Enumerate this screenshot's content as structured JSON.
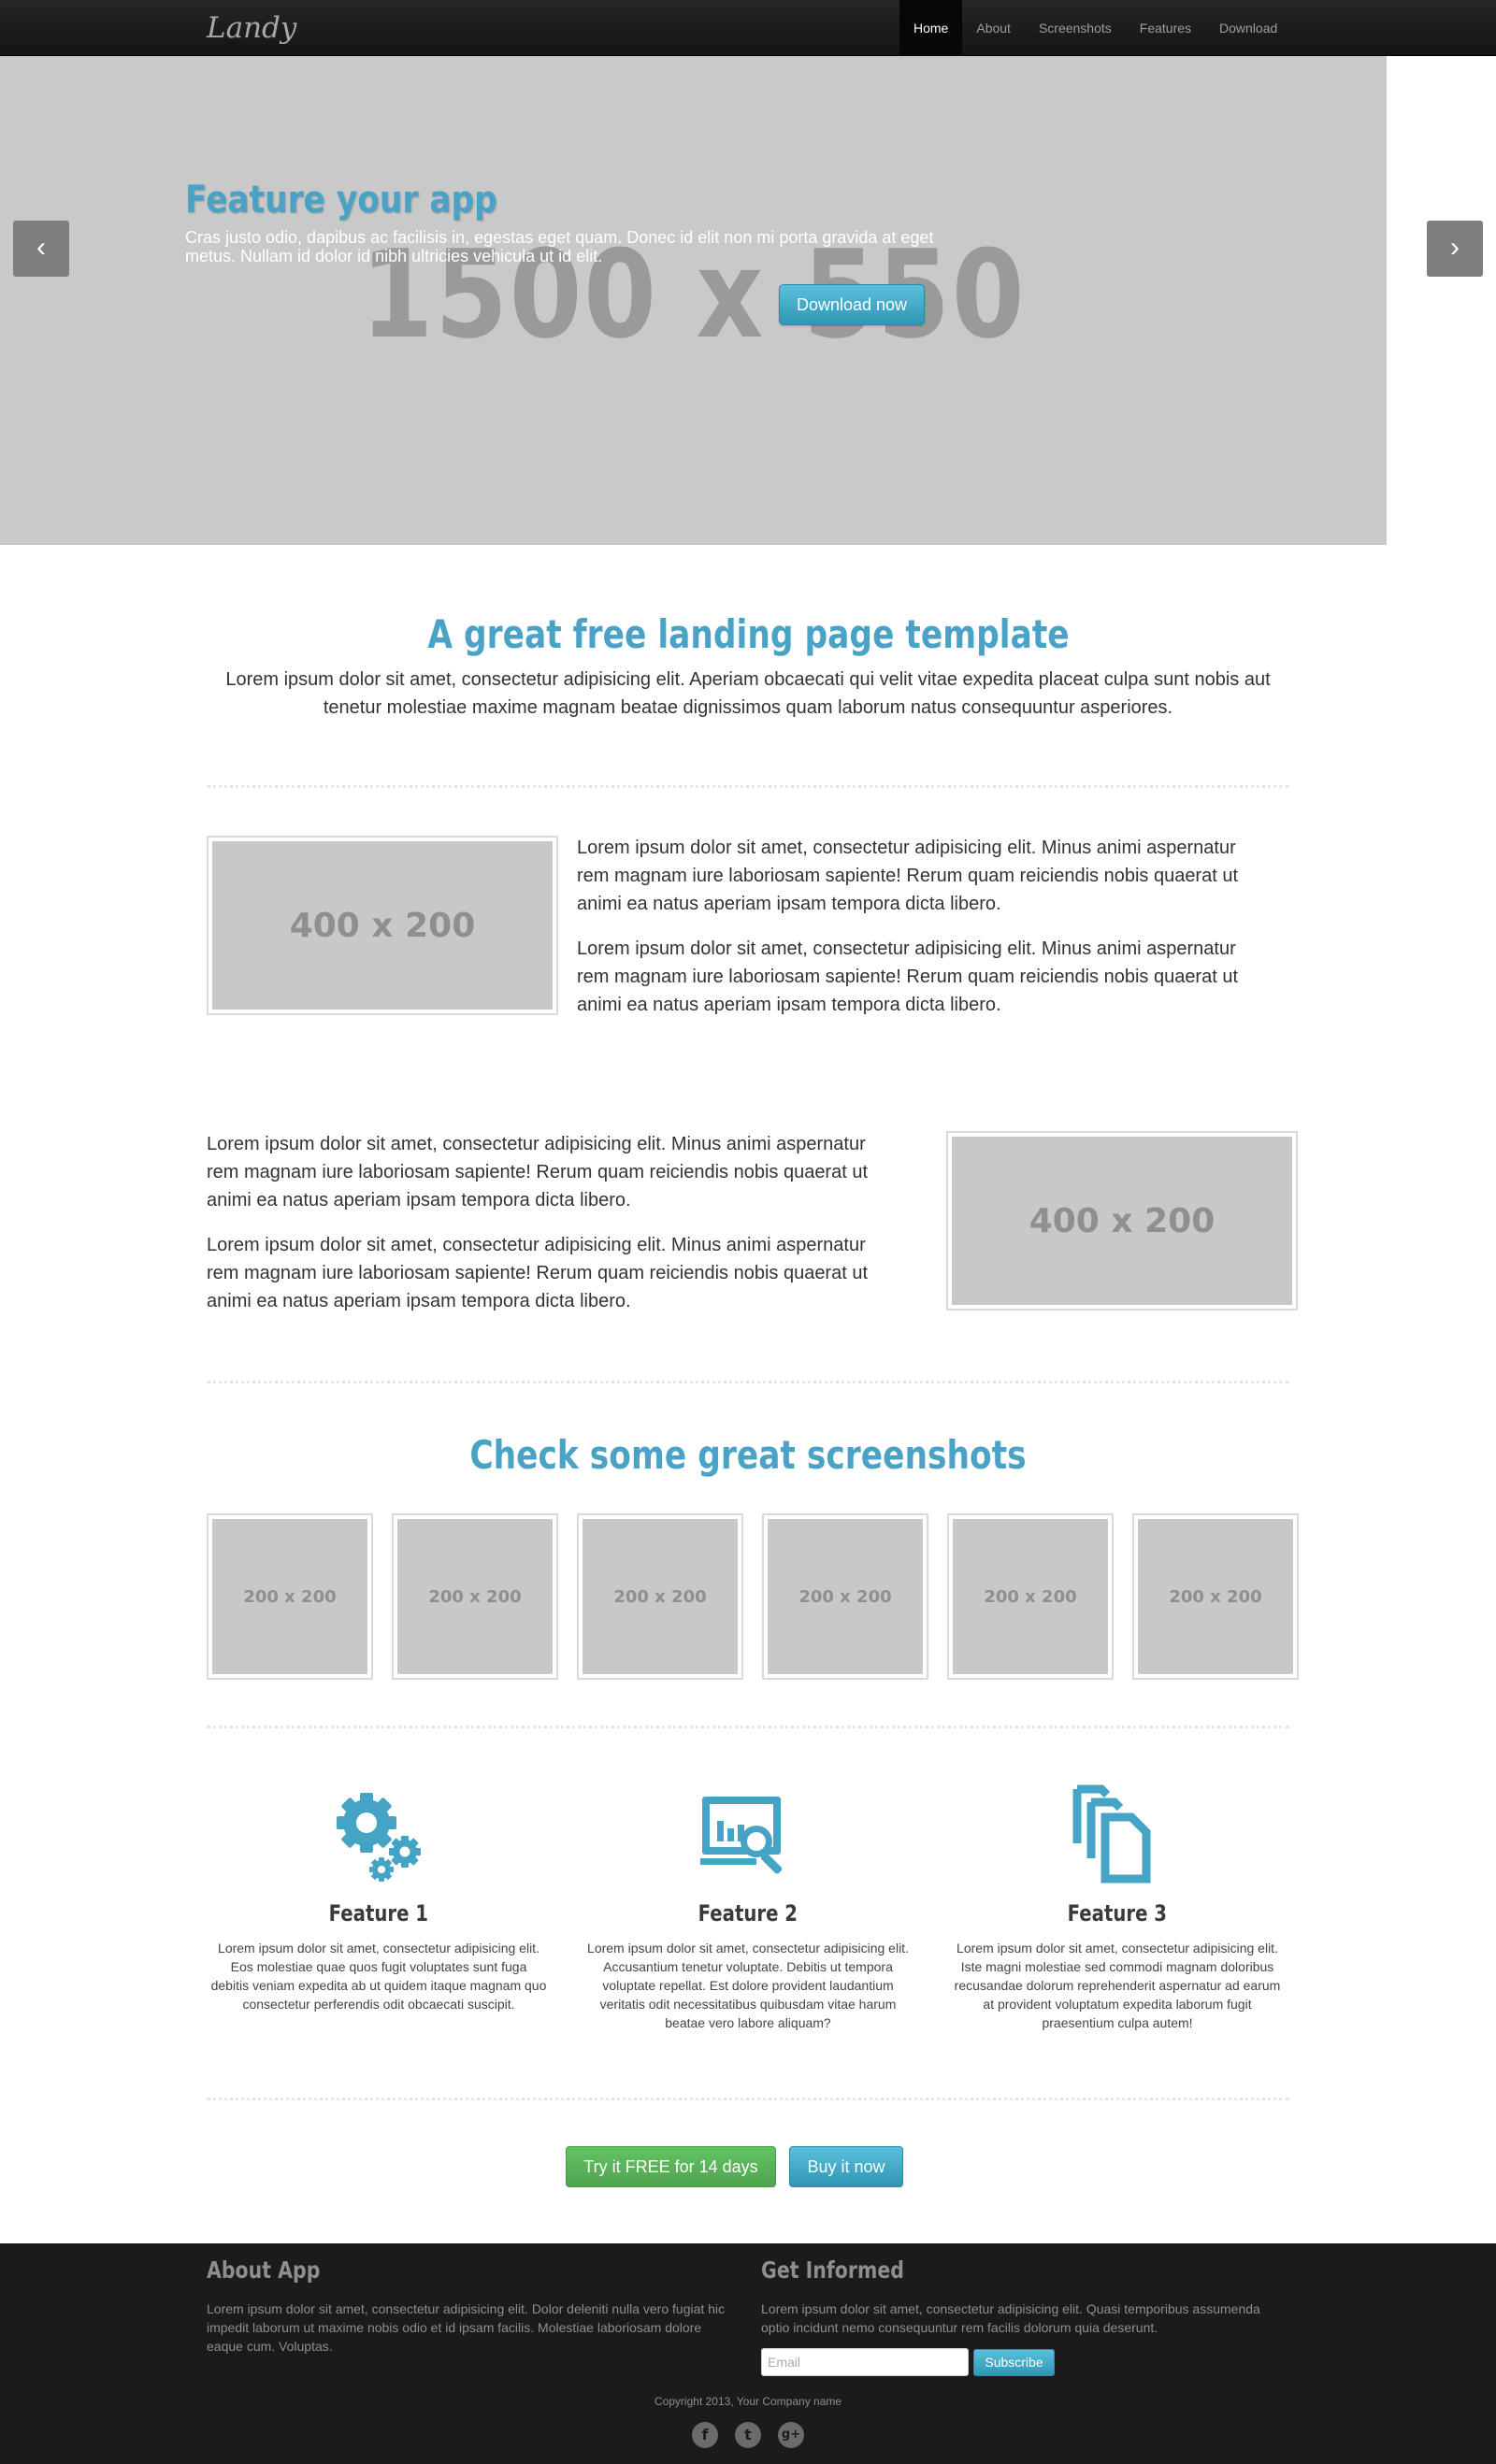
{
  "navbar": {
    "brand": "Landy",
    "items": [
      {
        "label": "Home",
        "active": true
      },
      {
        "label": "About",
        "active": false
      },
      {
        "label": "Screenshots",
        "active": false
      },
      {
        "label": "Features",
        "active": false
      },
      {
        "label": "Download",
        "active": false
      }
    ]
  },
  "hero": {
    "placeholder_label": "1500 x 550",
    "title": "Feature your app",
    "text": "Cras justo odio, dapibus ac facilisis in, egestas eget quam. Donec id elit non mi porta gravida at eget metus. Nullam id dolor id nibh ultricies vehicula ut id elit.",
    "button": "Download now",
    "prev_arrow": "‹",
    "next_arrow": "›"
  },
  "intro": {
    "title": "A great free landing page template",
    "text": "Lorem ipsum dolor sit amet, consectetur adipisicing elit. Aperiam obcaecati qui velit vitae expedita placeat culpa sunt nobis aut tenetur molestiae maxime magnam beatae dignissimos quam laborum natus consequuntur asperiores."
  },
  "rows": [
    {
      "image_label": "400 x 200",
      "paragraphs": [
        "Lorem ipsum dolor sit amet, consectetur adipisicing elit. Minus animi aspernatur rem magnam iure laboriosam sapiente! Rerum quam reiciendis nobis quaerat ut animi ea natus aperiam ipsam tempora dicta libero.",
        "Lorem ipsum dolor sit amet, consectetur adipisicing elit. Minus animi aspernatur rem magnam iure laboriosam sapiente! Rerum quam reiciendis nobis quaerat ut animi ea natus aperiam ipsam tempora dicta libero."
      ]
    },
    {
      "image_label": "400 x 200",
      "paragraphs": [
        "Lorem ipsum dolor sit amet, consectetur adipisicing elit. Minus animi aspernatur rem magnam iure laboriosam sapiente! Rerum quam reiciendis nobis quaerat ut animi ea natus aperiam ipsam tempora dicta libero.",
        "Lorem ipsum dolor sit amet, consectetur adipisicing elit. Minus animi aspernatur rem magnam iure laboriosam sapiente! Rerum quam reiciendis nobis quaerat ut animi ea natus aperiam ipsam tempora dicta libero."
      ]
    }
  ],
  "screenshots": {
    "title": "Check some great screenshots",
    "items": [
      "200 x 200",
      "200 x 200",
      "200 x 200",
      "200 x 200",
      "200 x 200",
      "200 x 200"
    ]
  },
  "features": [
    {
      "icon": "gears-icon",
      "title": "Feature 1",
      "text": "Lorem ipsum dolor sit amet, consectetur adipisicing elit. Eos molestiae quae quos fugit voluptates sunt fuga debitis veniam expedita ab ut quidem itaque magnam quo consectetur perferendis odit obcaecati suscipit."
    },
    {
      "icon": "analytics-search-icon",
      "title": "Feature 2",
      "text": "Lorem ipsum dolor sit amet, consectetur adipisicing elit. Accusantium tenetur voluptate. Debitis ut tempora voluptate repellat. Est dolore provident laudantium veritatis odit necessitatibus quibusdam vitae harum beatae vero labore aliquam?"
    },
    {
      "icon": "documents-icon",
      "title": "Feature 3",
      "text": "Lorem ipsum dolor sit amet, consectetur adipisicing elit. Iste magni molestiae sed commodi magnam doloribus recusandae dolorum reprehenderit aspernatur ad earum at provident voluptatum expedita laborum fugit praesentium culpa autem!"
    }
  ],
  "cta": {
    "trial": "Try it FREE for 14 days",
    "buy": "Buy it now"
  },
  "footer": {
    "about_title": "About App",
    "about_text": "Lorem ipsum dolor sit amet, consectetur adipisicing elit. Dolor deleniti nulla vero fugiat hic impedit laborum ut maxime nobis odio et id ipsam facilis. Molestiae laboriosam dolore eaque cum. Voluptas.",
    "informed_title": "Get Informed",
    "informed_text": "Lorem ipsum dolor sit amet, consectetur adipisicing elit. Quasi temporibus assumenda optio incidunt nemo consequuntur rem facilis dolorum quia deserunt.",
    "email_placeholder": "Email",
    "subscribe": "Subscribe",
    "copyright": "Copyright 2013, Your Company name",
    "social": [
      {
        "icon": "facebook-icon",
        "glyph": "f"
      },
      {
        "icon": "twitter-icon",
        "glyph": "t"
      },
      {
        "icon": "google-plus-icon",
        "glyph": "g+"
      }
    ]
  },
  "colors": {
    "accent": "#4aa3c7",
    "navbar": "#1a1a1a",
    "footer": "#1b1b1b",
    "success": "#5bb75b",
    "info": "#49afcd"
  }
}
